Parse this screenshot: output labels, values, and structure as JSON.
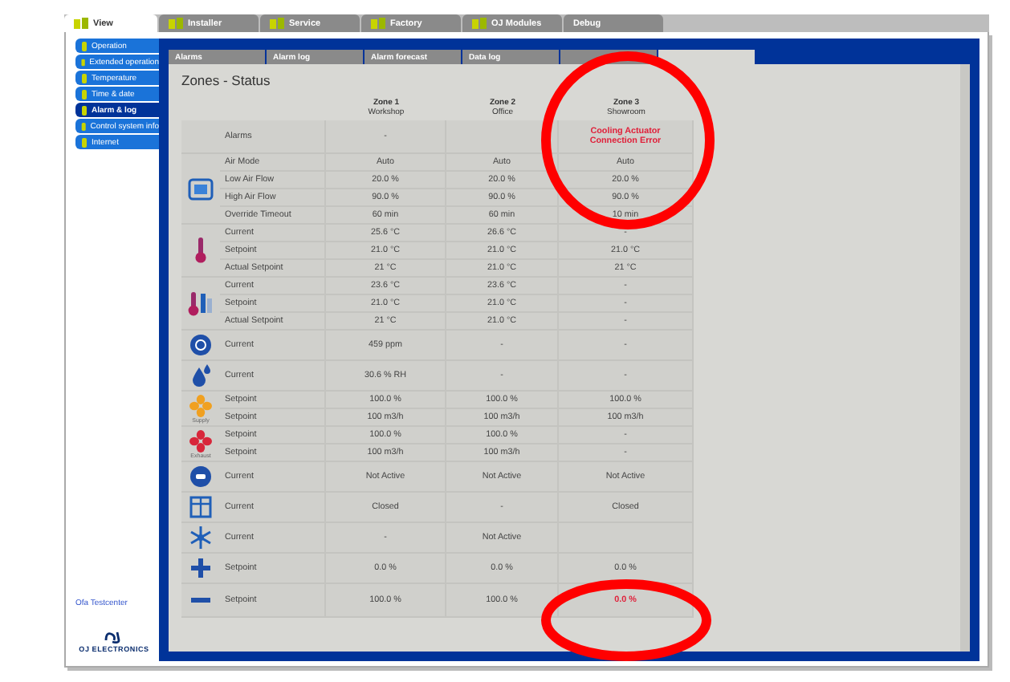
{
  "top_tabs": [
    {
      "label": "View",
      "selected": true
    },
    {
      "label": "Installer",
      "selected": false
    },
    {
      "label": "Service",
      "selected": false
    },
    {
      "label": "Factory",
      "selected": false
    },
    {
      "label": "OJ Modules",
      "selected": false
    },
    {
      "label": "Debug",
      "selected": false
    }
  ],
  "sidebar": {
    "items": [
      {
        "label": "Operation",
        "selected": false
      },
      {
        "label": "Extended operation",
        "selected": false
      },
      {
        "label": "Temperature",
        "selected": false
      },
      {
        "label": "Time & date",
        "selected": false
      },
      {
        "label": "Alarm & log",
        "selected": true
      },
      {
        "label": "Control system info",
        "selected": false
      },
      {
        "label": "Internet",
        "selected": false
      }
    ],
    "footer_link": "Ofa Testcenter",
    "logo": "OJ ELECTRONICS"
  },
  "sub_tabs": [
    {
      "label": "Alarms",
      "selected": false
    },
    {
      "label": "Alarm log",
      "selected": false
    },
    {
      "label": "Alarm forecast",
      "selected": false
    },
    {
      "label": "Data log",
      "selected": false
    },
    {
      "selected": false
    },
    {
      "selected": true
    }
  ],
  "title": "Zones - Status",
  "zones": [
    {
      "name": "Zone 1",
      "place": "Workshop"
    },
    {
      "name": "Zone 2",
      "place": "Office"
    },
    {
      "name": "Zone 3",
      "place": "Showroom"
    }
  ],
  "groups": [
    {
      "kind": "none",
      "rows": [
        {
          "label": "Alarms",
          "cells": [
            {
              "text": "-",
              "alert": false
            },
            {
              "alert": false
            },
            {
              "text": "Cooling Actuator Connection Error",
              "alert": true
            }
          ]
        }
      ]
    },
    {
      "kind": "monitor",
      "rows": [
        {
          "label": "Air Mode",
          "cells": [
            {
              "text": "Auto",
              "alert": false
            },
            {
              "text": "Auto",
              "alert": false
            },
            {
              "text": "Auto",
              "alert": false
            }
          ]
        },
        {
          "label": "Low Air Flow",
          "cells": [
            {
              "text": "20.0 %",
              "alert": false
            },
            {
              "text": "20.0 %",
              "alert": false
            },
            {
              "text": "20.0 %",
              "alert": false
            }
          ]
        },
        {
          "label": "High Air Flow",
          "cells": [
            {
              "text": "90.0 %",
              "alert": false
            },
            {
              "text": "90.0 %",
              "alert": false
            },
            {
              "text": "90.0 %",
              "alert": false
            }
          ]
        },
        {
          "label": "Override Timeout",
          "cells": [
            {
              "text": "60 min",
              "alert": false
            },
            {
              "text": "60 min",
              "alert": false
            },
            {
              "text": "10 min",
              "alert": false
            }
          ]
        }
      ]
    },
    {
      "kind": "thermometer",
      "rows": [
        {
          "label": "Current",
          "cells": [
            {
              "text": "25.6 °C",
              "alert": false
            },
            {
              "text": "26.6 °C",
              "alert": false
            },
            {
              "text": "-",
              "alert": false
            }
          ]
        },
        {
          "label": "Setpoint",
          "cells": [
            {
              "text": "21.0 °C",
              "alert": false
            },
            {
              "text": "21.0 °C",
              "alert": false
            },
            {
              "text": "21.0 °C",
              "alert": false
            }
          ]
        },
        {
          "label": "Actual Setpoint",
          "cells": [
            {
              "text": "21 °C",
              "alert": false
            },
            {
              "text": "21.0 °C",
              "alert": false
            },
            {
              "text": "21 °C",
              "alert": false
            }
          ]
        }
      ]
    },
    {
      "kind": "floor",
      "rows": [
        {
          "label": "Current",
          "cells": [
            {
              "text": "23.6 °C",
              "alert": false
            },
            {
              "text": "23.6 °C",
              "alert": false
            },
            {
              "text": "-",
              "alert": false
            }
          ]
        },
        {
          "label": "Setpoint",
          "cells": [
            {
              "text": "21.0 °C",
              "alert": false
            },
            {
              "text": "21.0 °C",
              "alert": false
            },
            {
              "text": "-",
              "alert": false
            }
          ]
        },
        {
          "label": "Actual Setpoint",
          "cells": [
            {
              "text": "21 °C",
              "alert": false
            },
            {
              "text": "21.0 °C",
              "alert": false
            },
            {
              "text": "-",
              "alert": false
            }
          ]
        }
      ]
    },
    {
      "kind": "co2",
      "rows": [
        {
          "label": "Current",
          "cells": [
            {
              "text": "459 ppm",
              "alert": false
            },
            {
              "text": "-",
              "alert": false
            },
            {
              "text": "-",
              "alert": false
            }
          ]
        }
      ]
    },
    {
      "kind": "drop",
      "rows": [
        {
          "label": "Current",
          "cells": [
            {
              "text": "30.6 % RH",
              "alert": false
            },
            {
              "text": "-",
              "alert": false
            },
            {
              "text": "-",
              "alert": false
            }
          ]
        }
      ]
    },
    {
      "kind": "supply",
      "caption": "Supply",
      "rows": [
        {
          "label": "Setpoint",
          "cells": [
            {
              "text": "100.0 %",
              "alert": false
            },
            {
              "text": "100.0 %",
              "alert": false
            },
            {
              "text": "100.0 %",
              "alert": false
            }
          ]
        },
        {
          "label": "Setpoint",
          "cells": [
            {
              "text": "100 m3/h",
              "alert": false
            },
            {
              "text": "100 m3/h",
              "alert": false
            },
            {
              "text": "100 m3/h",
              "alert": false
            }
          ]
        }
      ]
    },
    {
      "kind": "exhaust",
      "caption": "Exhaust",
      "rows": [
        {
          "label": "Setpoint",
          "cells": [
            {
              "text": "100.0 %",
              "alert": false
            },
            {
              "text": "100.0 %",
              "alert": false
            },
            {
              "text": "-",
              "alert": false
            }
          ]
        },
        {
          "label": "Setpoint",
          "cells": [
            {
              "text": "100 m3/h",
              "alert": false
            },
            {
              "text": "100 m3/h",
              "alert": false
            },
            {
              "text": "-",
              "alert": false
            }
          ]
        }
      ]
    },
    {
      "kind": "pir",
      "rows": [
        {
          "label": "Current",
          "cells": [
            {
              "text": "Not Active",
              "alert": false
            },
            {
              "text": "Not Active",
              "alert": false
            },
            {
              "text": "Not Active",
              "alert": false
            }
          ]
        }
      ]
    },
    {
      "kind": "window",
      "rows": [
        {
          "label": "Current",
          "cells": [
            {
              "text": "Closed",
              "alert": false
            },
            {
              "text": "-",
              "alert": false
            },
            {
              "text": "Closed",
              "alert": false
            }
          ]
        }
      ]
    },
    {
      "kind": "snowflake",
      "rows": [
        {
          "label": "Current",
          "cells": [
            {
              "text": "-",
              "alert": false
            },
            {
              "text": "Not Active",
              "alert": false
            },
            {
              "alert": false
            }
          ]
        }
      ]
    },
    {
      "kind": "plus",
      "rows": [
        {
          "label": "Setpoint",
          "cells": [
            {
              "text": "0.0 %",
              "alert": false
            },
            {
              "text": "0.0 %",
              "alert": false
            },
            {
              "text": "0.0 %",
              "alert": false
            }
          ]
        }
      ]
    },
    {
      "kind": "minus",
      "rows": [
        {
          "label": "Setpoint",
          "cells": [
            {
              "text": "100.0 %",
              "alert": false
            },
            {
              "text": "100.0 %",
              "alert": false
            },
            {
              "text": "0.0 %",
              "alert": true
            }
          ]
        }
      ]
    }
  ],
  "annotations": [
    {
      "kind": "ellipse"
    },
    {
      "kind": "ellipse"
    }
  ]
}
